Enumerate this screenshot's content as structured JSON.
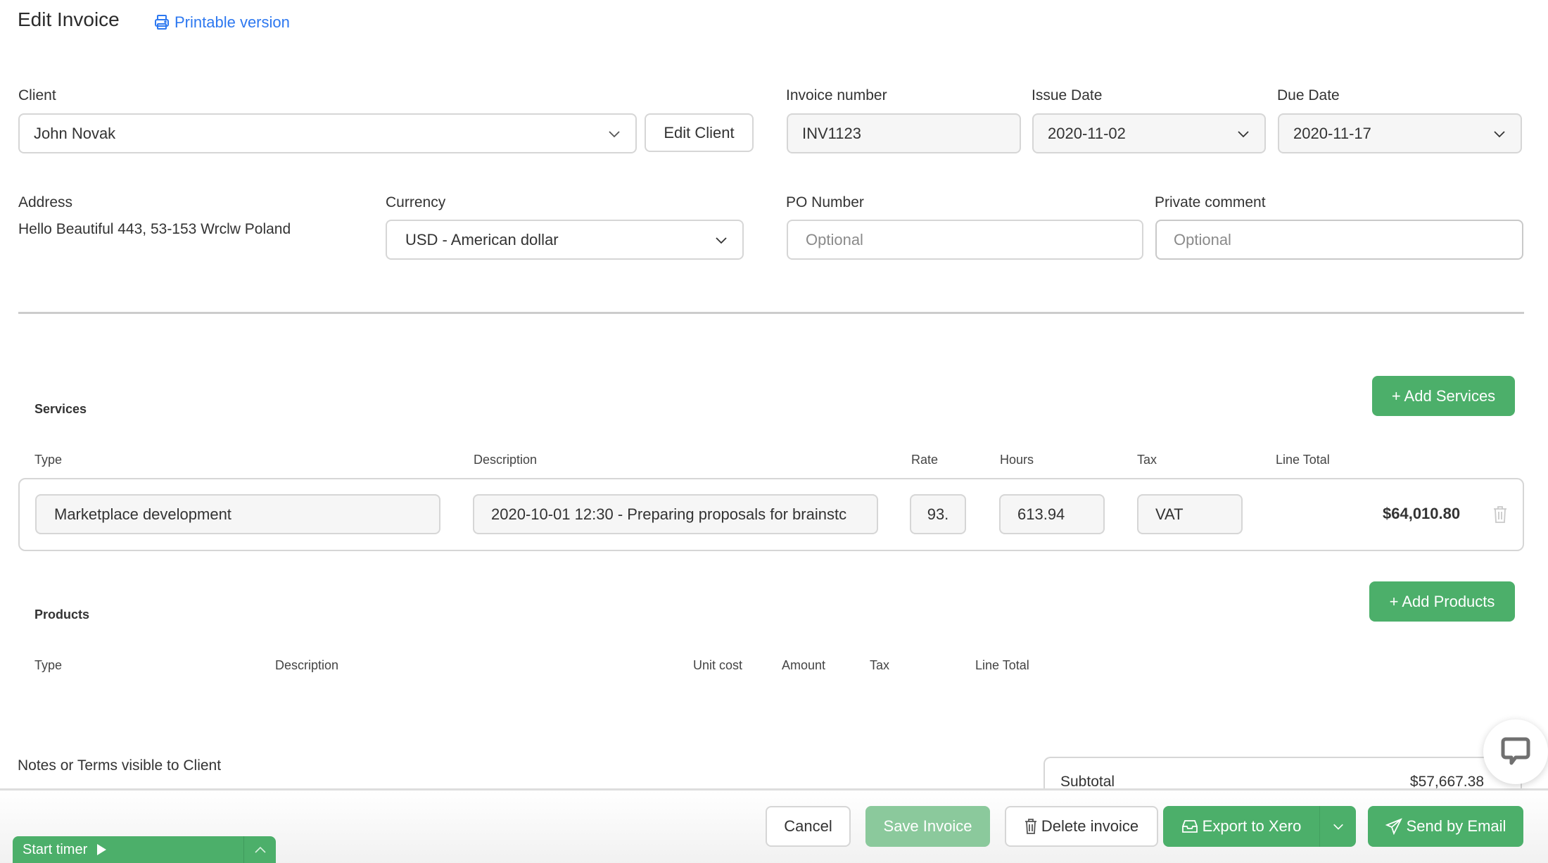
{
  "header": {
    "title": "Edit Invoice",
    "printable_link": "Printable version",
    "printable_icon": "printer-icon"
  },
  "form": {
    "client": {
      "label": "Client",
      "value": "John Novak",
      "edit_button": "Edit Client"
    },
    "invoice_number": {
      "label": "Invoice number",
      "value": "INV1123"
    },
    "issue_date": {
      "label": "Issue Date",
      "value": "2020-11-02"
    },
    "due_date": {
      "label": "Due Date",
      "value": "2020-11-17"
    },
    "address": {
      "label": "Address",
      "value": "Hello Beautiful 443, 53-153 Wrclw Poland"
    },
    "currency": {
      "label": "Currency",
      "value": "USD - American dollar"
    },
    "po_number": {
      "label": "PO Number",
      "placeholder": "Optional"
    },
    "private_comment": {
      "label": "Private comment",
      "placeholder": "Optional"
    }
  },
  "services": {
    "title": "Services",
    "add_button": "+ Add Services",
    "columns": [
      "Type",
      "Description",
      "Rate",
      "Hours",
      "Tax",
      "Line Total"
    ],
    "rows": [
      {
        "type": "Marketplace development",
        "description": "2020-10-01 12:30 - Preparing proposals for brainstc",
        "rate": "93.",
        "hours": "613.94",
        "tax": "VAT",
        "line_total": "$64,010.80"
      }
    ]
  },
  "products": {
    "title": "Products",
    "add_button": "+ Add Products",
    "columns": [
      "Type",
      "Description",
      "Unit cost",
      "Amount",
      "Tax",
      "Line Total"
    ]
  },
  "notes": {
    "label": "Notes or Terms visible to Client"
  },
  "totals": {
    "subtotal_label": "Subtotal",
    "subtotal_value": "$57,667.38"
  },
  "actions": {
    "cancel": "Cancel",
    "save": "Save Invoice",
    "delete": "Delete invoice",
    "export": "Export to Xero",
    "send": "Send by Email"
  },
  "timer": {
    "label": "Start timer"
  },
  "colors": {
    "accent_green": "#4caf6a",
    "accent_green_disabled": "#8bc99c",
    "link_blue": "#2d78f0"
  }
}
